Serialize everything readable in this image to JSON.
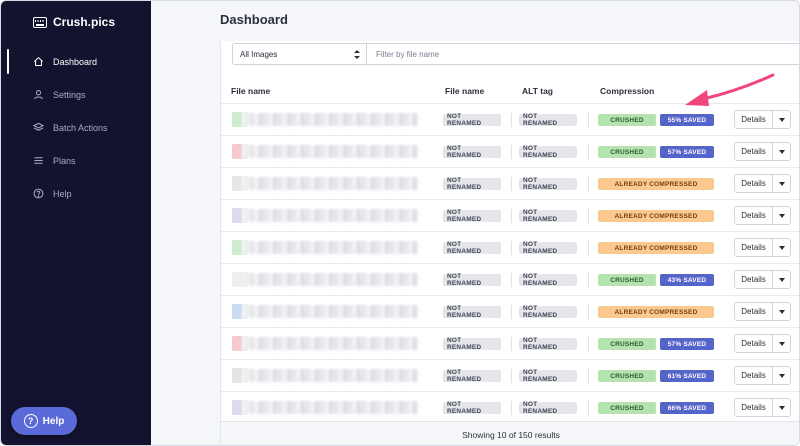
{
  "app": {
    "brand": "Crush.pics"
  },
  "sidebar": {
    "items": [
      {
        "label": "Dashboard",
        "icon": "home-icon",
        "active": true
      },
      {
        "label": "Settings",
        "icon": "user-icon",
        "active": false
      },
      {
        "label": "Batch Actions",
        "icon": "layers-icon",
        "active": false
      },
      {
        "label": "Plans",
        "icon": "list-icon",
        "active": false
      },
      {
        "label": "Help",
        "icon": "help-circle-icon",
        "active": false
      }
    ],
    "help_button": "Help"
  },
  "page": {
    "title": "Dashboard"
  },
  "filters": {
    "select_value": "All Images",
    "search_placeholder": "Filter by file name"
  },
  "table": {
    "headers": {
      "file_name": "File name",
      "file_name_status": "File name",
      "alt_tag": "ALT tag",
      "compression": "Compression"
    },
    "rows": [
      {
        "thumb_color": "#cdeccd",
        "file_status": "NOT RENAMED",
        "alt_status": "NOT RENAMED",
        "compression": "CRUSHED",
        "saved": "55% SAVED",
        "details": "Details"
      },
      {
        "thumb_color": "#f6c9cc",
        "file_status": "NOT RENAMED",
        "alt_status": "NOT RENAMED",
        "compression": "CRUSHED",
        "saved": "57% SAVED",
        "details": "Details"
      },
      {
        "thumb_color": "#e6e6e6",
        "file_status": "NOT RENAMED",
        "alt_status": "NOT RENAMED",
        "compression": "ALREADY COMPRESSED",
        "saved": "",
        "details": "Details"
      },
      {
        "thumb_color": "#dcd9ee",
        "file_status": "NOT RENAMED",
        "alt_status": "NOT RENAMED",
        "compression": "ALREADY COMPRESSED",
        "saved": "",
        "details": "Details"
      },
      {
        "thumb_color": "#cdeccd",
        "file_status": "NOT RENAMED",
        "alt_status": "NOT RENAMED",
        "compression": "ALREADY COMPRESSED",
        "saved": "",
        "details": "Details"
      },
      {
        "thumb_color": "#eeeeee",
        "file_status": "NOT RENAMED",
        "alt_status": "NOT RENAMED",
        "compression": "CRUSHED",
        "saved": "43% SAVED",
        "details": "Details"
      },
      {
        "thumb_color": "#c8dcf4",
        "file_status": "NOT RENAMED",
        "alt_status": "NOT RENAMED",
        "compression": "ALREADY COMPRESSED",
        "saved": "",
        "details": "Details"
      },
      {
        "thumb_color": "#f6c9cc",
        "file_status": "NOT RENAMED",
        "alt_status": "NOT RENAMED",
        "compression": "CRUSHED",
        "saved": "57% SAVED",
        "details": "Details"
      },
      {
        "thumb_color": "#e4e4e4",
        "file_status": "NOT RENAMED",
        "alt_status": "NOT RENAMED",
        "compression": "CRUSHED",
        "saved": "61% SAVED",
        "details": "Details"
      },
      {
        "thumb_color": "#dcd9ee",
        "file_status": "NOT RENAMED",
        "alt_status": "NOT RENAMED",
        "compression": "CRUSHED",
        "saved": "66% SAVED",
        "details": "Details"
      }
    ],
    "footer": "Showing 10 of 150 results"
  },
  "colors": {
    "sidebar_bg": "#14132f",
    "accent": "#5464c9",
    "crushed": "#b5e3b0",
    "already_compressed": "#fdc790",
    "annotation_arrow": "#f0467a"
  }
}
